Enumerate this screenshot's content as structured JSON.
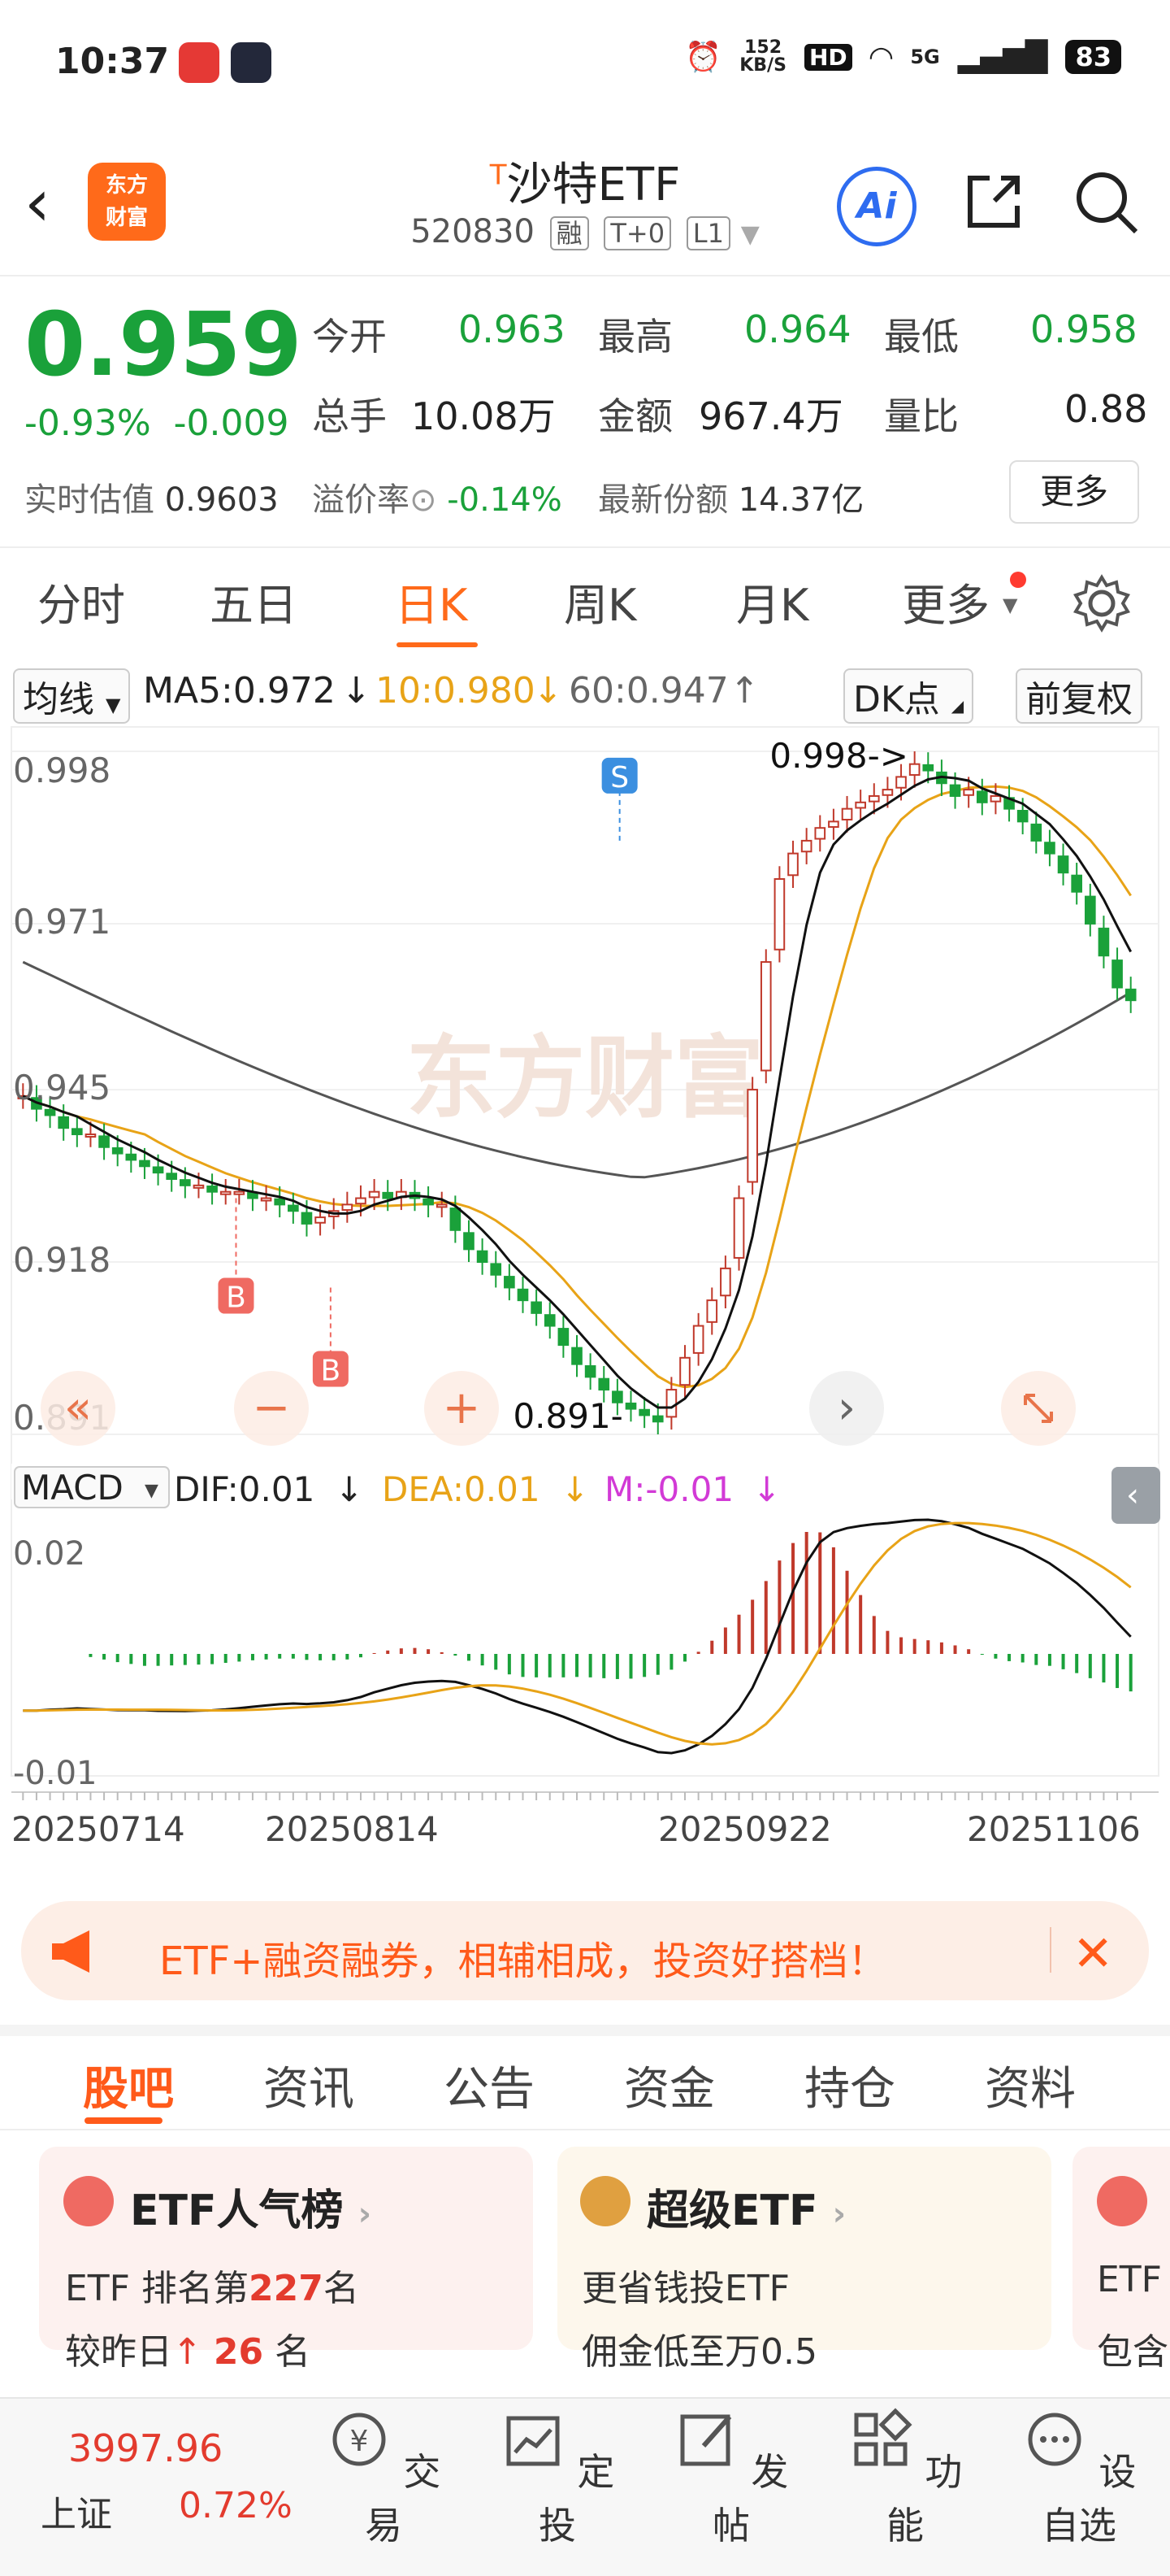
{
  "status_bar": {
    "time": "10:37",
    "net_speed_top": "152",
    "net_speed_bottom": "KB/S",
    "hd": "HD",
    "net": "5G",
    "battery": "83"
  },
  "header": {
    "title": "沙特ETF",
    "title_mark": "T",
    "code": "520830",
    "tags": [
      "融",
      "T+0",
      "L1"
    ],
    "logo_line1": "东方",
    "logo_line2": "财富",
    "ai_label": "Ai"
  },
  "quote": {
    "price": "0.959",
    "change_pct": "-0.93%",
    "change_abs": "-0.009",
    "open_label": "今开",
    "open": "0.963",
    "high_label": "最高",
    "high": "0.964",
    "low_label": "最低",
    "low": "0.958",
    "volume_label": "总手",
    "volume": "10.08万",
    "amount_label": "金额",
    "amount": "967.4万",
    "ratio_label": "量比",
    "ratio": "0.88",
    "est_label": "实时估值",
    "est": "0.9603",
    "premium_label": "溢价率",
    "premium": "-0.14%",
    "shares_label": "最新份额",
    "shares": "14.37亿",
    "more_label": "更多"
  },
  "period_tabs": [
    "分时",
    "五日",
    "日K",
    "周K",
    "月K",
    "更多"
  ],
  "active_period": "日K",
  "indicator_row": {
    "ma_selector": "均线",
    "ma5": "MA5:0.972",
    "ma10": "10:0.980",
    "ma60": "60:0.947",
    "dk_label": "DK点",
    "fq_label": "前复权"
  },
  "chart_data": {
    "type": "candlestick",
    "y_ticks": [
      "0.998",
      "0.971",
      "0.945",
      "0.918",
      "0.891"
    ],
    "ylim": [
      0.891,
      0.998
    ],
    "x_ticks": [
      "20250714",
      "20250814",
      "20250922",
      "20251106"
    ],
    "annotations": {
      "high": "0.998",
      "low": "0.891"
    },
    "signals": [
      "B",
      "B",
      "S"
    ],
    "closes": [
      0.944,
      0.942,
      0.941,
      0.939,
      0.938,
      0.938,
      0.936,
      0.935,
      0.934,
      0.933,
      0.932,
      0.931,
      0.93,
      0.93,
      0.929,
      0.929,
      0.929,
      0.928,
      0.928,
      0.927,
      0.926,
      0.924,
      0.925,
      0.926,
      0.927,
      0.928,
      0.929,
      0.928,
      0.929,
      0.928,
      0.927,
      0.927,
      0.923,
      0.92,
      0.918,
      0.916,
      0.914,
      0.912,
      0.91,
      0.908,
      0.905,
      0.902,
      0.9,
      0.898,
      0.896,
      0.895,
      0.894,
      0.893,
      0.898,
      0.903,
      0.908,
      0.912,
      0.917,
      0.928,
      0.945,
      0.965,
      0.978,
      0.982,
      0.984,
      0.986,
      0.987,
      0.989,
      0.99,
      0.991,
      0.992,
      0.994,
      0.996,
      0.995,
      0.993,
      0.991,
      0.992,
      0.99,
      0.991,
      0.989,
      0.987,
      0.984,
      0.982,
      0.979,
      0.976,
      0.971,
      0.966,
      0.961,
      0.959
    ],
    "macd": {
      "dif": "DIF:0.01",
      "dea": "DEA:0.01",
      "m": "M:-0.01",
      "y_ticks": [
        "0.02",
        "-0.01"
      ]
    }
  },
  "chart_controls": {
    "rewind": "«",
    "zoom_out": "−",
    "zoom_in": "+",
    "forward": "›"
  },
  "watermark": "东方财富",
  "promo": {
    "text": "ETF+融资融券，相辅相成，投资好搭档！"
  },
  "bottom_tabs": [
    "股吧",
    "资讯",
    "公告",
    "资金",
    "持仓",
    "资料"
  ],
  "cards": [
    {
      "title": "ETF人气榜",
      "line1_prefix": "ETF 排名第",
      "line1_num": "227",
      "line1_suffix": "名",
      "line2_prefix": "较昨日",
      "line2_arrow": "↑",
      "line2_num": "26",
      "line2_suffix": "名"
    },
    {
      "title": "超级ETF",
      "line1": "更省钱投ETF",
      "line2": "佣金低至万0.5"
    },
    {
      "title": "",
      "line1": "ETF",
      "line2": "包含"
    }
  ],
  "bottom_bar": {
    "index_value": "3997.96",
    "index_name": "上证",
    "index_change": "0.72%",
    "items": [
      "交易",
      "定投",
      "发帖",
      "功能",
      "设自选"
    ]
  }
}
